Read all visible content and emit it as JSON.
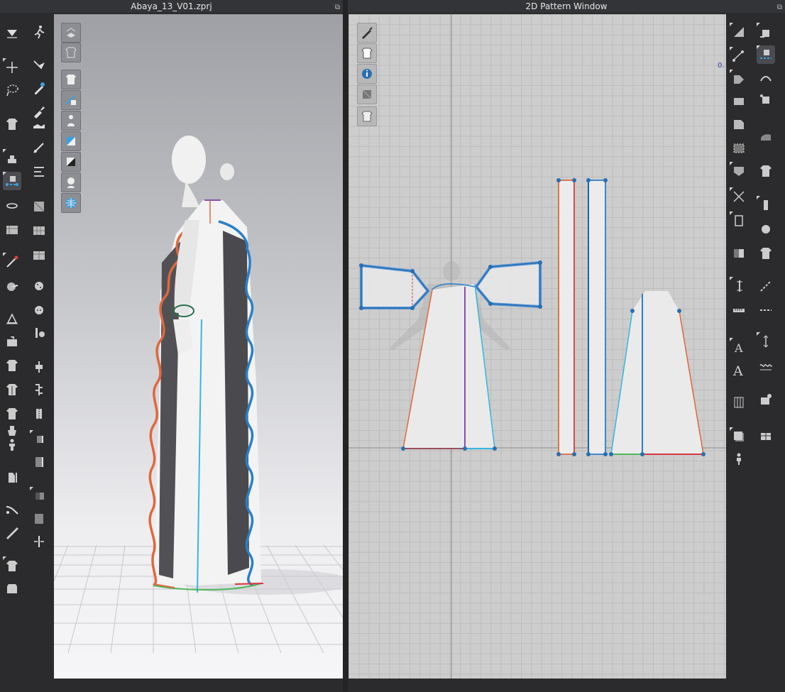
{
  "left_window": {
    "title": "Abaya_13_V01.zprj"
  },
  "right_window": {
    "title": "2D Pattern Window",
    "coord_readout": "0."
  },
  "icons": {
    "left_toolbar": [
      "select-move-icon",
      "walk-icon",
      "transform-icon",
      "move-pin-icon",
      "lasso-icon",
      "edit-pattern-icon",
      "avatar-garment-icon",
      "brush-icon",
      "fold-icon",
      "steam-icon",
      "sewing-icon",
      "segment-sewing-icon",
      "free-sewing-icon",
      "tack-icon",
      "fabric-icon",
      "texture-icon",
      "measure-icon",
      "pin-icon",
      "circle-pin-icon",
      "button-icon",
      "lock-icon",
      "zipper-icon",
      "shirt-icon",
      "zip-icon",
      "avatar-pose-icon",
      "tape-icon",
      "strap-icon",
      "shrink-icon",
      "puckering-icon",
      "gradient-icon",
      "ruler-icon",
      "arrow-split-icon",
      "piping-icon",
      "shirt-fold-icon"
    ],
    "viewport_toolbar": [
      "show-avatar-icon",
      "show-garment-icon",
      "garment-view-icon",
      "sewing-view-icon",
      "avatar-view-icon",
      "texture-view-icon",
      "shaded-view-icon",
      "skin-view-icon",
      "mesh-view-icon"
    ],
    "pattern_toolbar": [
      "pattern-brush-icon",
      "show-garment-2d-icon",
      "pattern-info-icon",
      "texture-2d-icon",
      "lock-pattern-icon"
    ],
    "right_toolbar": [
      "transform-pattern-icon",
      "segment-sewing-icon-2",
      "edit-point-icon",
      "curve-point-icon",
      "polygon-icon",
      "rectangle-icon",
      "internal-polygon-icon",
      "seam-allowance-icon",
      "trace-icon",
      "fold-arrange-icon",
      "symmetry-icon",
      "notch-icon",
      "text-tool-icon",
      "text-style-icon",
      "grade-icon",
      "pin-2d-icon",
      "button-2d-icon",
      "zipper-2d-icon",
      "stitch-icon",
      "gradient-2d-icon",
      "iron-icon",
      "avatar-2d-icon"
    ]
  },
  "colors": {
    "ui_bg": "#2b2b2d",
    "seam_orange": "#e0673e",
    "seam_blue": "#2a7fc9",
    "seam_cyan": "#37b6e0",
    "seam_purple": "#8a4fb0",
    "seam_green": "#4fb85a",
    "seam_red": "#d9363e",
    "selected_blue": "#4a90d9"
  }
}
